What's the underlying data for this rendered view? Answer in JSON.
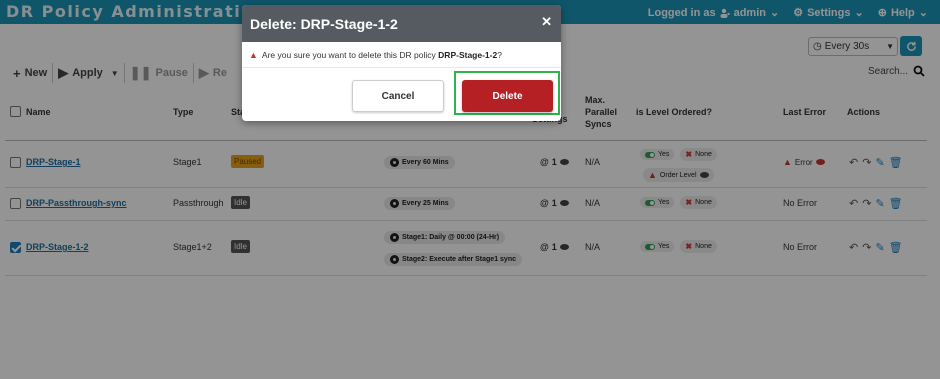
{
  "header": {
    "title": "DR Policy Administration",
    "logged_in_label": "Logged in as",
    "user": "admin",
    "settings": "Settings",
    "help": "Help"
  },
  "toolbar": {
    "new": "New",
    "apply": "Apply",
    "pause": "Pause",
    "resume_partial": "Re",
    "refresh_interval": "Every 30s",
    "search_label": "Search..."
  },
  "table": {
    "columns": {
      "name": "Name",
      "type": "Type",
      "status_partial": "Sta",
      "settings_partial": "Settings",
      "max_parallel_syncs_line1": "Max.",
      "max_parallel_syncs_line2": "Parallel",
      "max_parallel_syncs_line3": "Syncs",
      "level_ordered": "is Level Ordered?",
      "last_error": "Last Error",
      "actions": "Actions"
    },
    "rows": [
      {
        "name": "DRP-Stage-1",
        "type": "Stage1",
        "status": "Paused",
        "schedule": [
          "Every 60 Mins"
        ],
        "settings_count": "1",
        "max_parallel": "N/A",
        "level_yes": "Yes",
        "level_none": "None",
        "order_level": "Order Level",
        "last_error": "Error",
        "checked": false
      },
      {
        "name": "DRP-Passthrough-sync",
        "type": "Passthrough",
        "status": "Idle",
        "schedule": [
          "Every 25 Mins"
        ],
        "settings_count": "1",
        "max_parallel": "N/A",
        "level_yes": "Yes",
        "level_none": "None",
        "last_error": "No Error",
        "checked": false
      },
      {
        "name": "DRP-Stage-1-2",
        "type": "Stage1+2",
        "status": "Idle",
        "schedule": [
          "Stage1: Daily @ 00:00 (24-Hr)",
          "Stage2: Execute after Stage1 sync"
        ],
        "settings_count": "1",
        "max_parallel": "N/A",
        "level_yes": "Yes",
        "level_none": "None",
        "last_error": "No Error",
        "checked": true
      }
    ]
  },
  "modal": {
    "title": "Delete: DRP-Stage-1-2",
    "message_prefix": "Are you sure you want to delete this DR policy",
    "policy_name": "DRP-Stage-1-2",
    "message_suffix": "?",
    "cancel": "Cancel",
    "delete": "Delete"
  },
  "colors": {
    "header_bg": "#1b95b8",
    "modal_header": "#555b61",
    "delete_btn": "#b52025",
    "highlight_frame": "#2db34a"
  }
}
